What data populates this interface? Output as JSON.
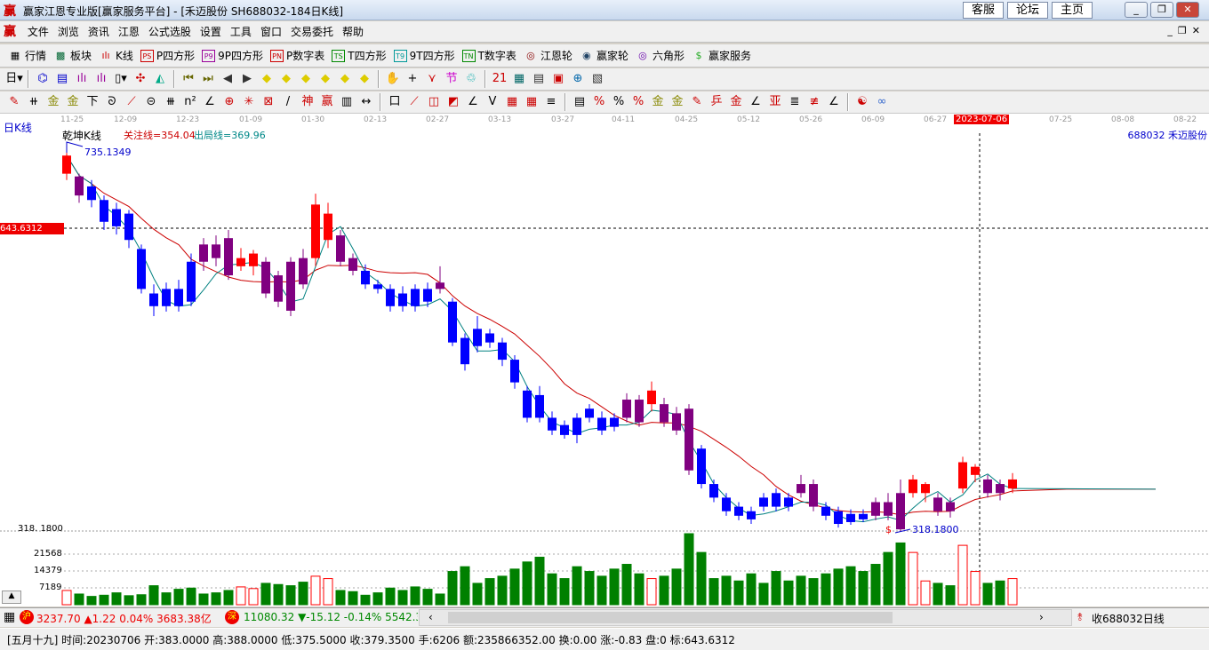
{
  "window": {
    "title": "赢家江恩专业版[赢家服务平台] - [禾迈股份  SH688032-184日K线]",
    "buttons": [
      "客服",
      "论坛",
      "主页"
    ],
    "controls": [
      "_",
      "❐",
      "✕"
    ]
  },
  "menu": {
    "logo": "赢",
    "items": [
      "文件",
      "浏览",
      "资讯",
      "江恩",
      "公式选股",
      "设置",
      "工具",
      "窗口",
      "交易委托",
      "帮助"
    ],
    "controls": [
      "_",
      "❐",
      "✕"
    ]
  },
  "toolbar1": [
    {
      "icon": "grid-table-icon",
      "glyph": "▦",
      "color": "#000",
      "label": "行情"
    },
    {
      "icon": "blocks-icon",
      "glyph": "▩",
      "color": "#063",
      "label": "板块"
    },
    {
      "icon": "kline-icon",
      "glyph": "ılı",
      "color": "#c00",
      "label": "K线"
    },
    {
      "icon": "ps-icon",
      "glyph": "PS",
      "color": "#c00",
      "label": "P四方形",
      "box": true
    },
    {
      "icon": "p9-icon",
      "glyph": "P9",
      "color": "#909",
      "label": "9P四方形",
      "box": true
    },
    {
      "icon": "pn-icon",
      "glyph": "PN",
      "color": "#c00",
      "label": "P数字表",
      "box": true
    },
    {
      "icon": "ts-icon",
      "glyph": "TS",
      "color": "#080",
      "label": "T四方形",
      "box": true
    },
    {
      "icon": "t9-icon",
      "glyph": "T9",
      "color": "#099",
      "label": "9T四方形",
      "box": true
    },
    {
      "icon": "tn-icon",
      "glyph": "TN",
      "color": "#080",
      "label": "T数字表",
      "box": true
    },
    {
      "icon": "gann-wheel-icon",
      "glyph": "◎",
      "color": "#800",
      "label": "江恩轮"
    },
    {
      "icon": "winner-wheel-icon",
      "glyph": "◉",
      "color": "#246",
      "label": "赢家轮"
    },
    {
      "icon": "hexagon-icon",
      "glyph": "◎",
      "color": "#60a",
      "label": "六角形"
    },
    {
      "icon": "dollar-icon",
      "glyph": "$",
      "color": "#2a2",
      "label": "赢家服务"
    }
  ],
  "toolbar2": [
    {
      "icon": "period-day-dropdown",
      "glyph": "日▾",
      "color": "#000"
    },
    {
      "sep": 1
    },
    {
      "icon": "chart-style-icon",
      "glyph": "⌬",
      "color": "#00c"
    },
    {
      "icon": "notes-icon",
      "glyph": "▤",
      "color": "#00c"
    },
    {
      "icon": "kline3-icon",
      "glyph": "ılı",
      "color": "#909"
    },
    {
      "icon": "kline9-icon",
      "glyph": "ılı",
      "color": "#909"
    },
    {
      "icon": "candle-dropdown",
      "glyph": "▯▾",
      "color": "#000"
    },
    {
      "icon": "drawing-icon",
      "glyph": "✣",
      "color": "#c00"
    },
    {
      "icon": "palette-icon",
      "glyph": "◭",
      "color": "#0a8"
    },
    {
      "sep": 1
    },
    {
      "icon": "first-icon",
      "glyph": "⏮",
      "color": "#660"
    },
    {
      "icon": "last-icon",
      "glyph": "⏭",
      "color": "#660"
    },
    {
      "icon": "prev-icon",
      "glyph": "◀",
      "color": "#333"
    },
    {
      "icon": "next-icon",
      "glyph": "▶",
      "color": "#333"
    },
    {
      "icon": "zoom-left-icon",
      "glyph": "◆",
      "color": "#dc0"
    },
    {
      "icon": "zoom-right-icon",
      "glyph": "◆",
      "color": "#dc0"
    },
    {
      "icon": "expand-icon",
      "glyph": "◆",
      "color": "#dc0"
    },
    {
      "icon": "shrink-icon",
      "glyph": "◆",
      "color": "#dc0"
    },
    {
      "icon": "zoom-in-icon",
      "glyph": "◆",
      "color": "#dc0"
    },
    {
      "icon": "zoom-out-icon",
      "glyph": "◆",
      "color": "#dc0"
    },
    {
      "sep": 1
    },
    {
      "icon": "hand-icon",
      "glyph": "✋",
      "color": "#333"
    },
    {
      "icon": "crosshair-icon",
      "glyph": "+",
      "color": "#000"
    },
    {
      "icon": "line-tool-icon",
      "glyph": "⋎",
      "color": "#c00"
    },
    {
      "icon": "section-icon",
      "glyph": "节",
      "color": "#c0c"
    },
    {
      "icon": "formula-icon",
      "glyph": "♲",
      "color": "#0aa"
    },
    {
      "sep": 1
    },
    {
      "icon": "calendar-icon",
      "glyph": "21",
      "color": "#c00"
    },
    {
      "icon": "calculator-icon",
      "glyph": "▦",
      "color": "#066"
    },
    {
      "icon": "report-icon",
      "glyph": "▤",
      "color": "#333"
    },
    {
      "icon": "save-icon",
      "glyph": "▣",
      "color": "#c00"
    },
    {
      "icon": "network-icon",
      "glyph": "⊕",
      "color": "#06a"
    },
    {
      "icon": "export-icon",
      "glyph": "▧",
      "color": "#333"
    }
  ],
  "toolbar3": [
    {
      "icon": "pen-icon",
      "glyph": "✎",
      "color": "#c00"
    },
    {
      "icon": "parallel-lines-icon",
      "glyph": "⧺",
      "color": "#000"
    },
    {
      "icon": "gold-ratio-icon",
      "glyph": "金",
      "color": "#880"
    },
    {
      "icon": "gold-ratio2-icon",
      "glyph": "金",
      "color": "#880"
    },
    {
      "icon": "fib-icon",
      "glyph": "下",
      "color": "#000"
    },
    {
      "icon": "spiral-icon",
      "glyph": "ᘐ",
      "color": "#000"
    },
    {
      "icon": "fan-icon",
      "glyph": "⟋",
      "color": "#c00"
    },
    {
      "icon": "cycle-icon",
      "glyph": "⊝",
      "color": "#000"
    },
    {
      "icon": "grid-lines-icon",
      "glyph": "⧻",
      "color": "#000"
    },
    {
      "icon": "n-squared-icon",
      "glyph": "n²",
      "color": "#000"
    },
    {
      "icon": "angle-icon",
      "glyph": "∠",
      "color": "#000"
    },
    {
      "icon": "target-icon",
      "glyph": "⊕",
      "color": "#c00"
    },
    {
      "icon": "star-icon",
      "glyph": "✳",
      "color": "#c00"
    },
    {
      "icon": "box-icon",
      "glyph": "⊠",
      "color": "#c00"
    },
    {
      "icon": "slash-icon",
      "glyph": "/",
      "color": "#000"
    },
    {
      "icon": "god-icon",
      "glyph": "神",
      "color": "#c00"
    },
    {
      "icon": "winner-icon",
      "glyph": "赢",
      "color": "#c00"
    },
    {
      "icon": "number-grid-icon",
      "glyph": "▥",
      "color": "#000"
    },
    {
      "icon": "width-icon",
      "glyph": "↔",
      "color": "#000"
    },
    {
      "sep": 1
    },
    {
      "icon": "square-icon",
      "glyph": "口",
      "color": "#000"
    },
    {
      "icon": "gann-fan-icon",
      "glyph": "⟋",
      "color": "#c00"
    },
    {
      "icon": "arc-icon",
      "glyph": "◫",
      "color": "#c00"
    },
    {
      "icon": "box-fan-icon",
      "glyph": "◩",
      "color": "#c00"
    },
    {
      "icon": "triangle-icon",
      "glyph": "∠",
      "color": "#000"
    },
    {
      "icon": "v-icon",
      "glyph": "V",
      "color": "#000"
    },
    {
      "icon": "grid-red-icon",
      "glyph": "▦",
      "color": "#c00"
    },
    {
      "icon": "grid-red2-icon",
      "glyph": "▦",
      "color": "#c00"
    },
    {
      "icon": "channel-icon",
      "glyph": "≡",
      "color": "#000"
    },
    {
      "sep": 1
    },
    {
      "icon": "table-icon",
      "glyph": "▤",
      "color": "#000"
    },
    {
      "icon": "percent-red-icon",
      "glyph": "%",
      "color": "#c00"
    },
    {
      "icon": "percent-icon",
      "glyph": "%",
      "color": "#000"
    },
    {
      "icon": "percent-line-icon",
      "glyph": "%",
      "color": "#c00"
    },
    {
      "icon": "gold-circle-icon",
      "glyph": "金",
      "color": "#880"
    },
    {
      "icon": "gold-line-icon",
      "glyph": "金",
      "color": "#880"
    },
    {
      "icon": "pencil-icon",
      "glyph": "✎",
      "color": "#c00"
    },
    {
      "icon": "price-icon",
      "glyph": "乒",
      "color": "#c00"
    },
    {
      "icon": "gold-red-icon",
      "glyph": "金",
      "color": "#c00"
    },
    {
      "icon": "ray-icon",
      "glyph": "∠",
      "color": "#000"
    },
    {
      "icon": "level-icon",
      "glyph": "亚",
      "color": "#c00"
    },
    {
      "icon": "cycle2-icon",
      "glyph": "≣",
      "color": "#000"
    },
    {
      "icon": "shield-icon",
      "glyph": "≢",
      "color": "#c00"
    },
    {
      "icon": "angle-line-icon",
      "glyph": "∠",
      "color": "#000"
    },
    {
      "sep": 1
    },
    {
      "icon": "yinyang-icon",
      "glyph": "☯",
      "color": "#c00"
    },
    {
      "icon": "infinity-icon",
      "glyph": "∞",
      "color": "#36c"
    }
  ],
  "chart": {
    "period_label": "日K线",
    "indicator_name": "乾坤K线",
    "watch_line": "关注线=354.04",
    "exit_line": "出局线=369.96",
    "stock": "688032 禾迈股份",
    "crosshair_price": "643.6312",
    "crosshair_date": "2023-07-06",
    "high_label": "735.1349",
    "low_label": "318.1800",
    "low_marker": "$",
    "axis_low": "318. 1800",
    "vol_ticks": [
      "21568",
      "14379",
      "7189"
    ],
    "dates": [
      "11-25",
      "12-09",
      "12-23",
      "01-09",
      "01-30",
      "02-13",
      "02-27",
      "03-13",
      "03-27",
      "04-11",
      "04-25",
      "05-12",
      "05-26",
      "06-09",
      "06-27",
      "07-25",
      "08-08",
      "08-22"
    ],
    "colors": {
      "up": "#ff0000",
      "down": "#0000ff",
      "neutral": "#800080",
      "ma_short": "#008080",
      "ma_long": "#cc0000",
      "vol_up": "#ff0000",
      "vol_down": "#008000"
    }
  },
  "chart_data": {
    "type": "candlestick",
    "ylim": [
      318.18,
      735.13
    ],
    "ohlc": [
      [
        712,
        735,
        705,
        732
      ],
      [
        709,
        712,
        680,
        688
      ],
      [
        698,
        705,
        675,
        683
      ],
      [
        683,
        688,
        650,
        659
      ],
      [
        673,
        680,
        645,
        654
      ],
      [
        668,
        672,
        630,
        639
      ],
      [
        629,
        634,
        580,
        585
      ],
      [
        580,
        590,
        555,
        566
      ],
      [
        585,
        592,
        560,
        566
      ],
      [
        585,
        595,
        560,
        566
      ],
      [
        615,
        624,
        566,
        571
      ],
      [
        634,
        641,
        605,
        615
      ],
      [
        634,
        644,
        610,
        619
      ],
      [
        641,
        650,
        595,
        600
      ],
      [
        610,
        630,
        605,
        619
      ],
      [
        610,
        628,
        600,
        624
      ],
      [
        615,
        620,
        575,
        580
      ],
      [
        600,
        605,
        565,
        571
      ],
      [
        615,
        620,
        555,
        561
      ],
      [
        619,
        629,
        585,
        590
      ],
      [
        619,
        690,
        610,
        678
      ],
      [
        639,
        680,
        630,
        668
      ],
      [
        644,
        650,
        610,
        615
      ],
      [
        619,
        624,
        600,
        605
      ],
      [
        605,
        612,
        585,
        590
      ],
      [
        590,
        595,
        580,
        585
      ],
      [
        585,
        590,
        560,
        566
      ],
      [
        580,
        588,
        560,
        566
      ],
      [
        585,
        590,
        560,
        566
      ],
      [
        585,
        592,
        565,
        571
      ],
      [
        592,
        610,
        580,
        585
      ],
      [
        571,
        575,
        522,
        526
      ],
      [
        531,
        536,
        495,
        502
      ],
      [
        541,
        555,
        515,
        522
      ],
      [
        536,
        541,
        520,
        526
      ],
      [
        526,
        531,
        500,
        507
      ],
      [
        507,
        512,
        475,
        482
      ],
      [
        473,
        478,
        438,
        443
      ],
      [
        468,
        478,
        438,
        443
      ],
      [
        443,
        450,
        424,
        429
      ],
      [
        435,
        440,
        420,
        424
      ],
      [
        443,
        448,
        415,
        424
      ],
      [
        453,
        458,
        438,
        443
      ],
      [
        443,
        450,
        424,
        429
      ],
      [
        443,
        448,
        428,
        433
      ],
      [
        463,
        470,
        438,
        443
      ],
      [
        463,
        468,
        433,
        438
      ],
      [
        458,
        483,
        450,
        473
      ],
      [
        458,
        465,
        433,
        438
      ],
      [
        448,
        455,
        424,
        429
      ],
      [
        453,
        458,
        380,
        385
      ],
      [
        409,
        413,
        365,
        370
      ],
      [
        370,
        375,
        350,
        355
      ],
      [
        355,
        360,
        335,
        340
      ],
      [
        345,
        350,
        330,
        335
      ],
      [
        340,
        345,
        326,
        331
      ],
      [
        355,
        360,
        340,
        345
      ],
      [
        360,
        365,
        340,
        345
      ],
      [
        355,
        360,
        340,
        345
      ],
      [
        370,
        380,
        355,
        360
      ],
      [
        370,
        375,
        340,
        345
      ],
      [
        345,
        350,
        330,
        335
      ],
      [
        340,
        345,
        322,
        326
      ],
      [
        337,
        342,
        325,
        328
      ],
      [
        337,
        342,
        328,
        331
      ],
      [
        350,
        355,
        330,
        335
      ],
      [
        350,
        360,
        330,
        335
      ],
      [
        360,
        375,
        318.18,
        320
      ],
      [
        360,
        380,
        355,
        375
      ],
      [
        360,
        372,
        350,
        370
      ],
      [
        355,
        360,
        335,
        340
      ],
      [
        350,
        355,
        333,
        340
      ],
      [
        365,
        400,
        360,
        394
      ],
      [
        380,
        392,
        372,
        389
      ],
      [
        375,
        380,
        355,
        360
      ],
      [
        370,
        375,
        352,
        360
      ],
      [
        365,
        382,
        360,
        375
      ]
    ],
    "neutral_idx": [
      1,
      11,
      12,
      13,
      16,
      17,
      18,
      19,
      22,
      23,
      30,
      45,
      46,
      48,
      49,
      50,
      59,
      60,
      65,
      66,
      67,
      70,
      71,
      74,
      75
    ],
    "volume": [
      6000,
      4500,
      3500,
      4000,
      5000,
      3800,
      4200,
      8000,
      5000,
      6500,
      7000,
      4500,
      5000,
      6000,
      7500,
      6800,
      9000,
      8500,
      8000,
      9500,
      12000,
      11000,
      6000,
      5500,
      4000,
      5000,
      7000,
      6000,
      7500,
      6500,
      4500,
      14000,
      16000,
      9000,
      11000,
      12000,
      15000,
      18000,
      20000,
      13000,
      11000,
      16000,
      14000,
      12000,
      15000,
      17000,
      13000,
      11000,
      12000,
      15000,
      29900,
      22000,
      11000,
      12000,
      10000,
      13000,
      9000,
      14000,
      10000,
      12000,
      11000,
      13000,
      15000,
      16000,
      14000,
      17000,
      22000,
      26000,
      22000,
      10000,
      9000,
      8000,
      25000,
      14000,
      9000,
      10000,
      11000
    ],
    "ma_short_window": 3,
    "ma_long_window": 10
  },
  "ticker": {
    "sh_badge": "沪",
    "sh": "3237.70 ▲1.22 0.04% 3683.38亿",
    "sz_badge": "深",
    "sz": "11080.32 ▼-15.12 -0.14% 5542.38",
    "right": "收688032日线"
  },
  "status": "[五月十九] 时间:20230706 开:383.0000 高:388.0000 低:375.5000 收:379.3500 手:6206 额:235866352.00 换:0.00 涨:-0.83 盘:0 标:643.6312"
}
